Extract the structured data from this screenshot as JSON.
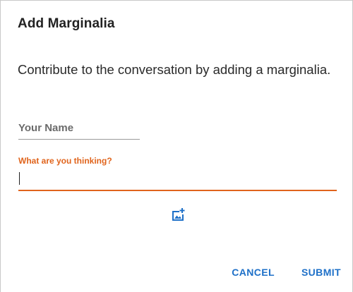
{
  "dialog": {
    "title": "Add Marginalia",
    "description": "Contribute to the conversation by adding a marginalia."
  },
  "form": {
    "name_placeholder": "Your Name",
    "name_value": "",
    "thought_label": "What are you thinking?",
    "thought_value": ""
  },
  "toolbar": {
    "add_image_icon": "add-photo-icon"
  },
  "actions": {
    "cancel_label": "CANCEL",
    "submit_label": "SUBMIT"
  },
  "colors": {
    "accent": "#e0641c",
    "primary": "#1e70c8",
    "text": "#222222"
  }
}
